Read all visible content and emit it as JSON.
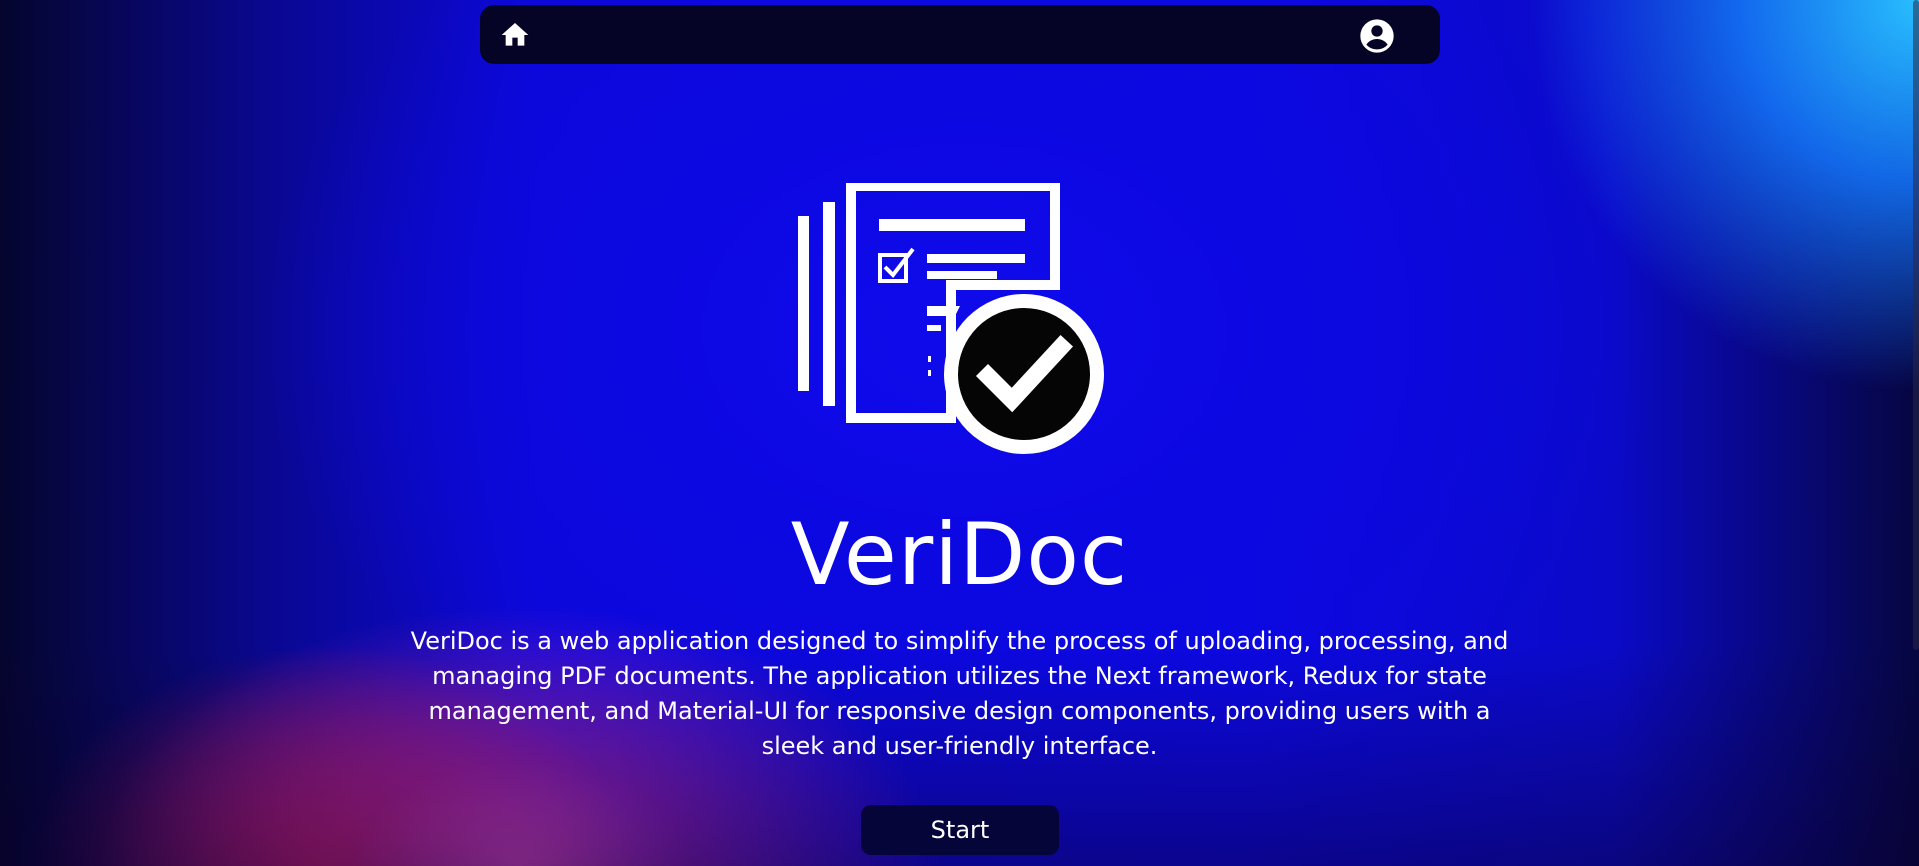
{
  "navbar": {
    "home_icon": "home-icon",
    "account_icon": "account-circle-icon"
  },
  "hero": {
    "logo_icon": "document-check-icon",
    "title": "VeriDoc",
    "description": "VeriDoc is a web application designed to simplify the process of uploading, processing, and managing PDF documents. The application utilizes the Next framework, Redux for state management, and Material-UI for responsive design components, providing users with a sleek and user-friendly interface.",
    "start_label": "Start"
  },
  "colors": {
    "navbar_bg": "#050326",
    "button_bg": "#06053a",
    "text": "#ffffff",
    "background_blue": "#0c08e0"
  }
}
